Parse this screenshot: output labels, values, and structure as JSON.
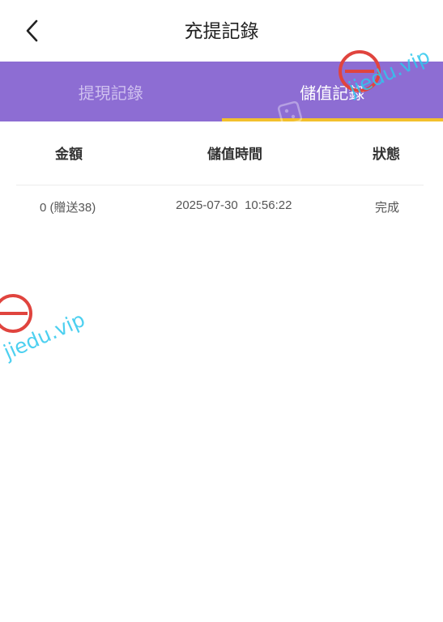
{
  "header": {
    "back_icon": "chevron-left-icon",
    "title": "充提記錄"
  },
  "tabs": [
    {
      "label": "提現記錄",
      "active": false
    },
    {
      "label": "儲值記錄",
      "active": true
    }
  ],
  "table": {
    "columns": [
      "金額",
      "儲值時間",
      "狀態"
    ],
    "rows": [
      {
        "amount": "0 (贈送38)",
        "time": "2025-07-30  10:56:22",
        "status": "完成"
      }
    ]
  },
  "watermarks": [
    "jiedu.vip",
    "jiedu.vip"
  ],
  "colors": {
    "tab_bar": "#8d6dd3",
    "tab_underline": "#f3c02c",
    "tab_inactive_text": "#cfc0ef",
    "tab_active_text": "#ffffff"
  }
}
